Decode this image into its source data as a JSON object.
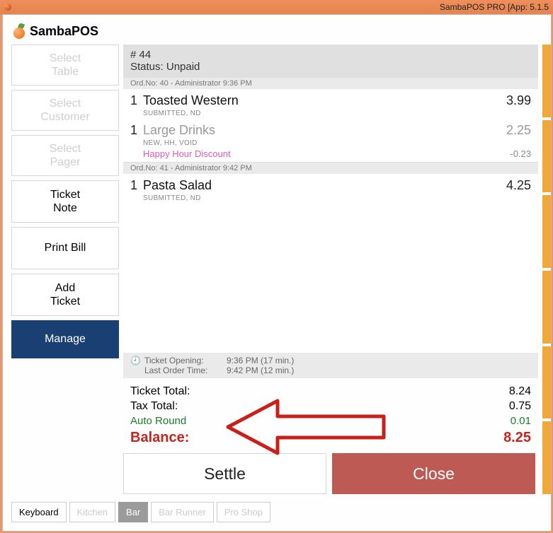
{
  "window": {
    "title": "SambaPOS PRO [App: 5.1.5"
  },
  "brand": "SambaPOS",
  "left": {
    "select_table": "Select\nTable",
    "select_customer": "Select\nCustomer",
    "select_pager": "Select\nPager",
    "ticket_note": "Ticket\nNote",
    "print_bill": "Print Bill",
    "add_ticket": "Add\nTicket",
    "manage": "Manage"
  },
  "ticket": {
    "number": "# 44",
    "status": "Status: Unpaid",
    "groups": [
      {
        "header": "Ord.No: 40 - Administrator  9:36 PM",
        "lines": [
          {
            "qty": "1",
            "name": "Toasted Western",
            "tags": "SUBMITTED, ND",
            "price": "3.99",
            "gray": false
          },
          {
            "qty": "1",
            "name": "Large Drinks",
            "tags": "NEW, HH, VOID",
            "price": "2.25",
            "gray": true,
            "discount": {
              "name": "Happy Hour Discount",
              "value": "-0.23"
            }
          }
        ]
      },
      {
        "header": "Ord.No: 41 - Administrator  9:42 PM",
        "lines": [
          {
            "qty": "1",
            "name": "Pasta Salad",
            "tags": "SUBMITTED, ND",
            "price": "4.25",
            "gray": false
          }
        ]
      }
    ]
  },
  "times": {
    "opening_label": "Ticket Opening:",
    "opening_value": "9:36 PM (17 min.)",
    "last_label": "Last Order Time:",
    "last_value": "9:42 PM (12 min.)"
  },
  "totals": {
    "ticket_total_label": "Ticket Total:",
    "ticket_total_value": "8.24",
    "tax_label": "Tax Total:",
    "tax_value": "0.75",
    "auto_round_label": "Auto Round",
    "auto_round_value": "0.01",
    "balance_label": "Balance:",
    "balance_value": "8.25"
  },
  "actions": {
    "settle": "Settle",
    "close": "Close"
  },
  "tabs": {
    "keyboard": "Keyboard",
    "kitchen": "Kitchen",
    "bar": "Bar",
    "bar_runner": "Bar Runner",
    "pro_shop": "Pro Shop"
  }
}
